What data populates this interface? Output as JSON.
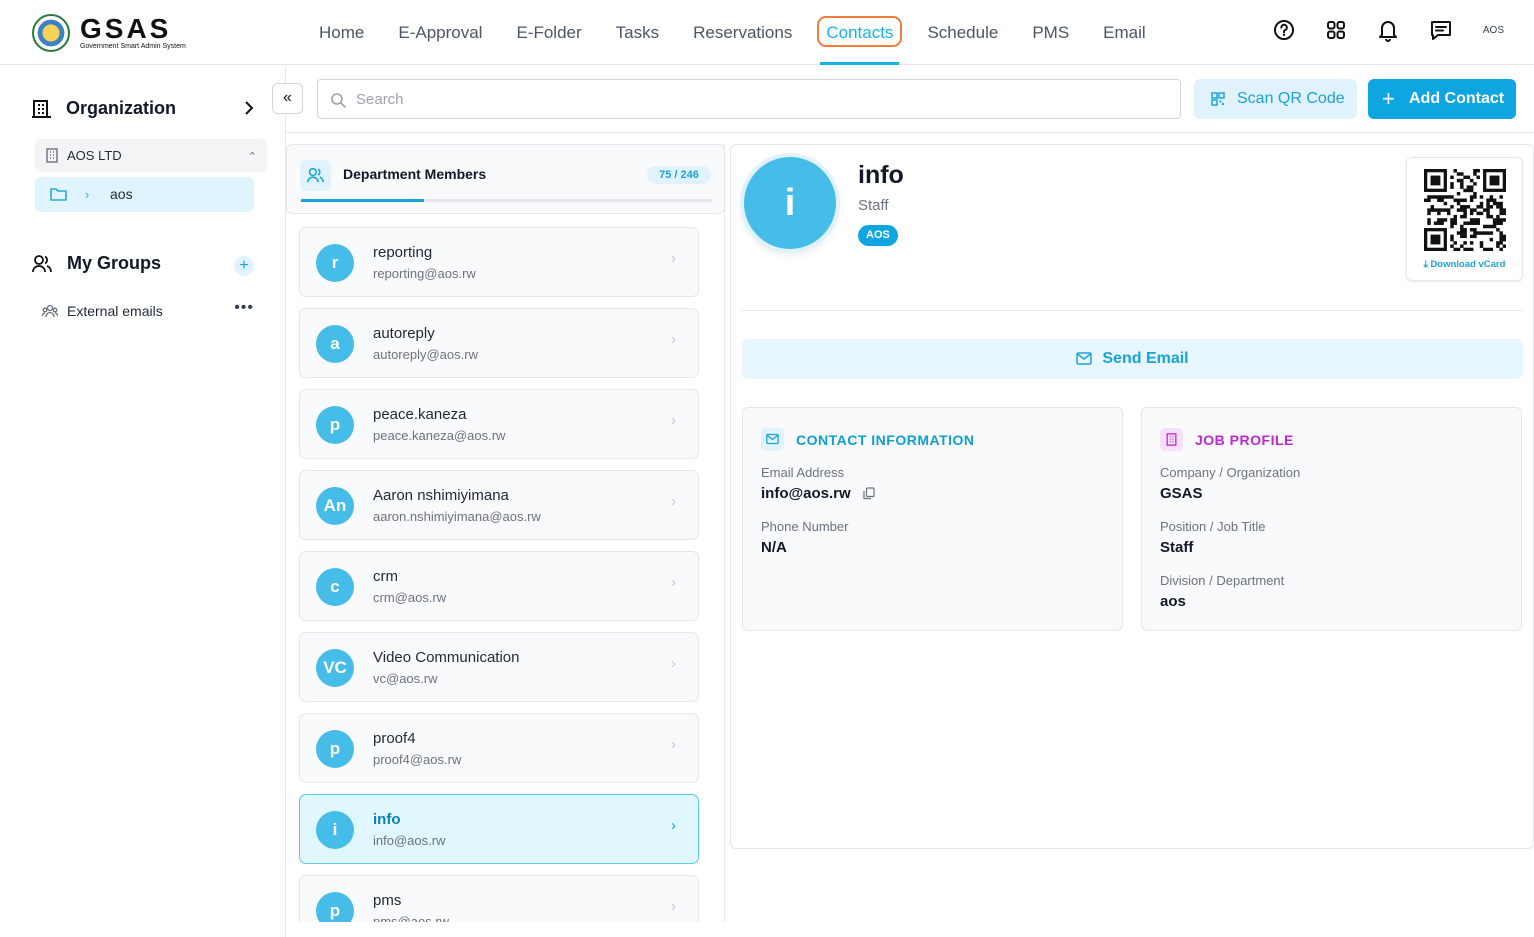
{
  "header": {
    "logo_title": "GSAS",
    "logo_subtitle": "Government Smart Admin System",
    "nav": [
      "Home",
      "E-Approval",
      "E-Folder",
      "Tasks",
      "Reservations",
      "Contacts",
      "Schedule",
      "PMS",
      "Email"
    ],
    "active_nav": "Contacts",
    "user_label": "AOS"
  },
  "sidebar": {
    "organization_title": "Organization",
    "org_selected": "AOS LTD",
    "folder": "aos",
    "groups_title": "My Groups",
    "groups": [
      "External emails"
    ]
  },
  "toolbar": {
    "search_placeholder": "Search",
    "scan_label": "Scan QR Code",
    "add_label": "Add Contact"
  },
  "members": {
    "title": "Department Members",
    "count": "75 / 246",
    "loaded_fraction": 0.3,
    "items": [
      {
        "initials": "r",
        "name": "reporting",
        "email": "reporting@aos.rw"
      },
      {
        "initials": "a",
        "name": "autoreply",
        "email": "autoreply@aos.rw"
      },
      {
        "initials": "p",
        "name": "peace.kaneza",
        "email": "peace.kaneza@aos.rw"
      },
      {
        "initials": "An",
        "name": "Aaron nshimiyimana",
        "email": "aaron.nshimiyimana@aos.rw"
      },
      {
        "initials": "c",
        "name": "crm",
        "email": "crm@aos.rw"
      },
      {
        "initials": "VC",
        "name": "Video Communication",
        "email": "vc@aos.rw"
      },
      {
        "initials": "p",
        "name": "proof4",
        "email": "proof4@aos.rw"
      },
      {
        "initials": "i",
        "name": "info",
        "email": "info@aos.rw"
      },
      {
        "initials": "p",
        "name": "pms",
        "email": "pms@aos.rw"
      }
    ],
    "selected_index": 7
  },
  "detail": {
    "initial": "i",
    "name": "info",
    "title": "Staff",
    "tag": "AOS",
    "download_label": "Download vCard",
    "send_email_label": "Send Email",
    "contact_info": {
      "heading": "CONTACT INFORMATION",
      "email_label": "Email Address",
      "email_value": "info@aos.rw",
      "phone_label": "Phone Number",
      "phone_value": "N/A"
    },
    "job_profile": {
      "heading": "JOB PROFILE",
      "company_label": "Company / Organization",
      "company_value": "GSAS",
      "position_label": "Position / Job Title",
      "position_value": "Staff",
      "division_label": "Division / Department",
      "division_value": "aos"
    }
  },
  "colors": {
    "accent": "#0ea5e0",
    "avatar": "#46bde9",
    "highlight_ring": "#f47b3c",
    "job_profile": "#c026d3"
  }
}
